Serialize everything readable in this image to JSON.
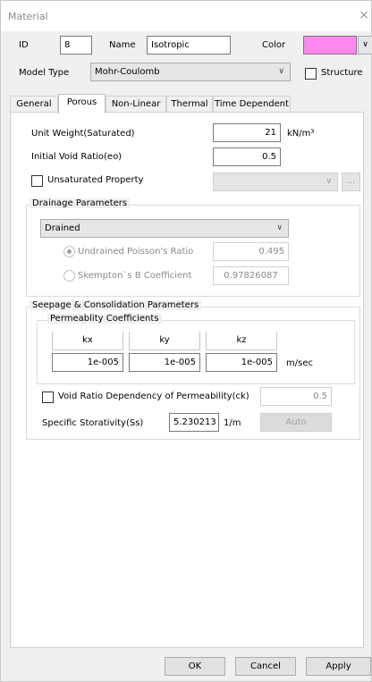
{
  "window": {
    "title": "Material",
    "close_glyph": "×"
  },
  "header": {
    "id_label": "ID",
    "id_value": "8",
    "name_label": "Name",
    "name_value": "Isotropic",
    "color_label": "Color",
    "color_value": "#ff88ee",
    "model_type_label": "Model Type",
    "model_type_value": "Mohr-Coulomb",
    "structure_label": "Structure",
    "structure_checked": false
  },
  "tabs": [
    {
      "label": "General",
      "active": false
    },
    {
      "label": "Porous",
      "active": true
    },
    {
      "label": "Non-Linear",
      "active": false
    },
    {
      "label": "Thermal",
      "active": false
    },
    {
      "label": "Time Dependent",
      "active": false
    }
  ],
  "porous": {
    "unit_weight_label": "Unit Weight(Saturated)",
    "unit_weight_value": "21",
    "unit_weight_unit": "kN/m³",
    "void_ratio_label": "Initial Void Ratio(eo)",
    "void_ratio_value": "0.5",
    "unsaturated_label": "Unsaturated Property",
    "unsaturated_checked": false,
    "unsaturated_combo_value": "",
    "ellipsis_label": "...",
    "drainage": {
      "title": "Drainage Parameters",
      "type_value": "Drained",
      "undrained_poisson_label": "Undrained Poisson's Ratio",
      "undrained_poisson_value": "0.495",
      "skempton_label": "Skempton`s B Coefficient",
      "skempton_value": "0.97826087"
    },
    "seepage": {
      "title": "Seepage & Consolidation Parameters",
      "permeability_title": "Permeablity Coefficients",
      "headers": [
        "kx",
        "ky",
        "kz"
      ],
      "values": [
        "1e-005",
        "1e-005",
        "1e-005"
      ],
      "unit": "m/sec",
      "void_ratio_dep_label": "Void Ratio Dependency of Permeability(ck)",
      "void_ratio_dep_checked": false,
      "void_ratio_dep_value": "0.5",
      "storativity_label": "Specific Storativity(Ss)",
      "storativity_value": "5.230213",
      "storativity_unit": "1/m",
      "auto_label": "Auto"
    }
  },
  "footer": {
    "ok": "OK",
    "cancel": "Cancel",
    "apply": "Apply"
  }
}
